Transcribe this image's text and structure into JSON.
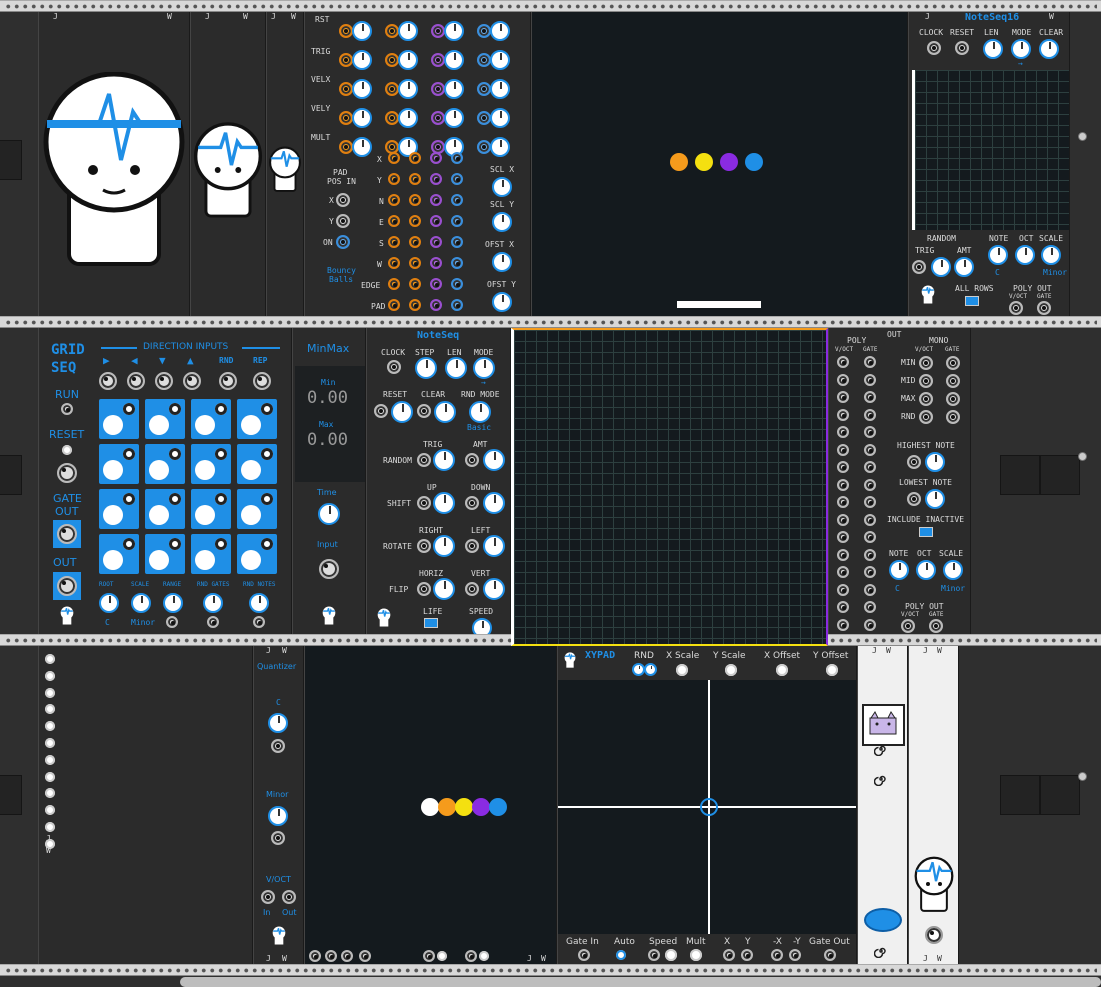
{
  "colors": {
    "accent": "#1f8fe6",
    "orange": "#f59b1c",
    "yellow": "#f4e010",
    "purple": "#8a2be2",
    "rail": "#d8d8d8"
  },
  "icons": [
    "mascot-face-icon",
    "cat-icon",
    "spiral-icon"
  ],
  "bouncy": {
    "rows": [
      "RST",
      "TRIG",
      "VELX",
      "VELY",
      "MULT"
    ],
    "inputs": [
      "X",
      "Y",
      "N",
      "E",
      "S",
      "W",
      "EDGE",
      "PAD"
    ],
    "pad_pos": {
      "title1": "PAD",
      "title2": "POS IN",
      "x": "X",
      "y": "Y",
      "on": "ON"
    },
    "scl_x": "SCL X",
    "scl_y": "SCL Y",
    "ofst_x": "OFST X",
    "ofst_y": "OFST Y",
    "name1": "Bouncy",
    "name2": "Balls"
  },
  "noteseq16": {
    "title": "NoteSeq16",
    "top": [
      "CLOCK",
      "RESET",
      "LEN",
      "MODE",
      "CLEAR"
    ],
    "random": "RANDOM",
    "trig": "TRIG",
    "amt": "AMT",
    "note": "NOTE",
    "oct": "OCT",
    "scale": "SCALE",
    "note_val": "C",
    "scale_val": "Minor",
    "all_rows": "ALL ROWS",
    "poly_out": "POLY OUT",
    "voct": "V/OCT",
    "gate": "GATE",
    "mode_arrow": "→"
  },
  "gridseq": {
    "title1": "GRID",
    "title2": "SEQ",
    "dir": "DIRECTION INPUTS",
    "arrows": [
      "▶",
      "◀",
      "▼",
      "▲"
    ],
    "rnd": "RND",
    "rep": "REP",
    "run": "RUN",
    "reset": "RESET",
    "gate": "GATE",
    "out_gate": "OUT",
    "out": "OUT",
    "bottom": [
      "ROOT",
      "SCALE",
      "RANGE",
      "RND GATES",
      "RND NOTES"
    ],
    "root_val": "C",
    "scale_val": "Minor"
  },
  "minmax": {
    "title": "MinMax",
    "min_label": "Min",
    "min_val": "0.00",
    "max_label": "Max",
    "max_val": "0.00",
    "time": "Time",
    "input": "Input"
  },
  "noteseq": {
    "title": "NoteSeq",
    "clock": "CLOCK",
    "step": "STEP",
    "len": "LEN",
    "mode": "MODE",
    "mode_arrow": "→",
    "reset": "RESET",
    "clear": "CLEAR",
    "rnd_mode": "RND MODE",
    "rnd_mode_val": "Basic",
    "random": "RANDOM",
    "trig": "TRIG",
    "amt": "AMT",
    "shift": "SHIFT",
    "up": "UP",
    "down": "DOWN",
    "rotate": "ROTATE",
    "right": "RIGHT",
    "left": "LEFT",
    "flip": "FLIP",
    "horiz": "HORIZ",
    "vert": "VERT",
    "life": "LIFE",
    "speed": "SPEED",
    "poly": "POLY",
    "out": "OUT",
    "mono": "MONO",
    "voct": "V/OCT",
    "gate": "GATE",
    "min": "MIN",
    "mid": "MID",
    "max": "MAX",
    "rnd": "RND",
    "highest": "HIGHEST NOTE",
    "lowest": "LOWEST NOTE",
    "include": "INCLUDE INACTIVE",
    "note": "NOTE",
    "oct": "OCT",
    "scale": "SCALE",
    "note_val": "C",
    "scale_val": "Minor",
    "poly_out": "POLY OUT"
  },
  "quantizer": {
    "title": "Quantizer",
    "root": "C",
    "scale": "Minor",
    "voct": "V/OCT",
    "in": "In",
    "out": "Out"
  },
  "xypad": {
    "title": "XYPAD",
    "rnd": "RND",
    "x_scale": "X Scale",
    "y_scale": "Y Scale",
    "x_offset": "X Offset",
    "y_offset": "Y Offset",
    "bottom": [
      "Gate In",
      "Auto",
      "Speed",
      "Mult",
      "X",
      "Y",
      "-X",
      "-Y",
      "Gate Out"
    ]
  },
  "brand": {
    "j": "J",
    "w": "W"
  }
}
